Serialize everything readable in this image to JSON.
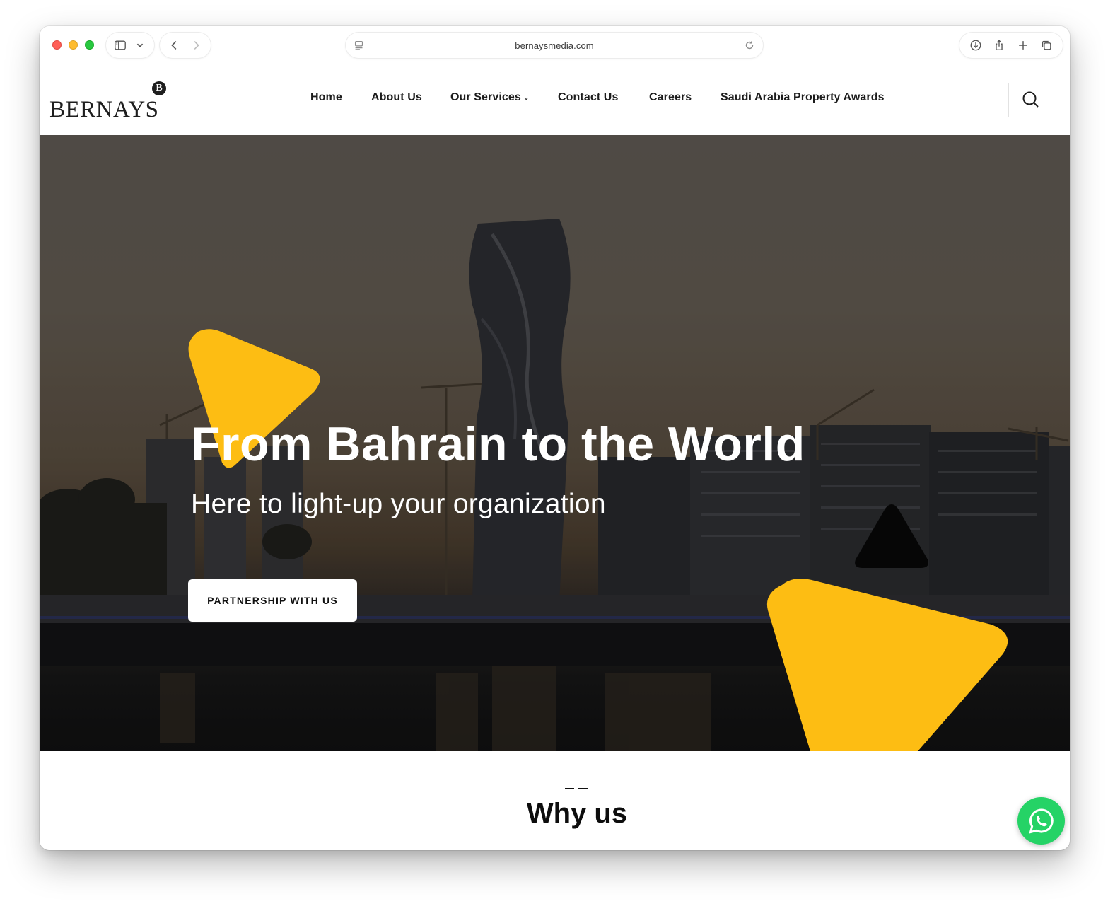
{
  "browser": {
    "url": "bernaysmedia.com",
    "icons": {
      "sidebar": "sidebar-icon",
      "chevron": "chevron-down-icon",
      "back": "back-arrow-icon",
      "forward": "forward-arrow-icon",
      "reader": "reader-icon",
      "reload": "reload-icon",
      "download": "download-icon",
      "share": "share-icon",
      "new_tab": "plus-icon",
      "tabs": "tabs-overview-icon"
    }
  },
  "site": {
    "logo_text": "BERNAYS",
    "logo_badge": "B",
    "nav": [
      {
        "label": "Home"
      },
      {
        "label": "About Us"
      },
      {
        "label": "Our Services",
        "has_dropdown": true
      },
      {
        "label": "Contact Us"
      },
      {
        "label": "Careers"
      },
      {
        "label": "Saudi Arabia Property Awards"
      }
    ],
    "caret": "⌄",
    "search_icon": "search-icon"
  },
  "hero": {
    "title": "From Bahrain to the World",
    "subtitle": "Here to light-up your organization",
    "cta_label": "PARTNERSHIP WITH US",
    "accent_color": "#fdbd13"
  },
  "why": {
    "title": "Why us"
  },
  "whatsapp": {
    "icon": "whatsapp-icon",
    "color": "#25d366"
  }
}
